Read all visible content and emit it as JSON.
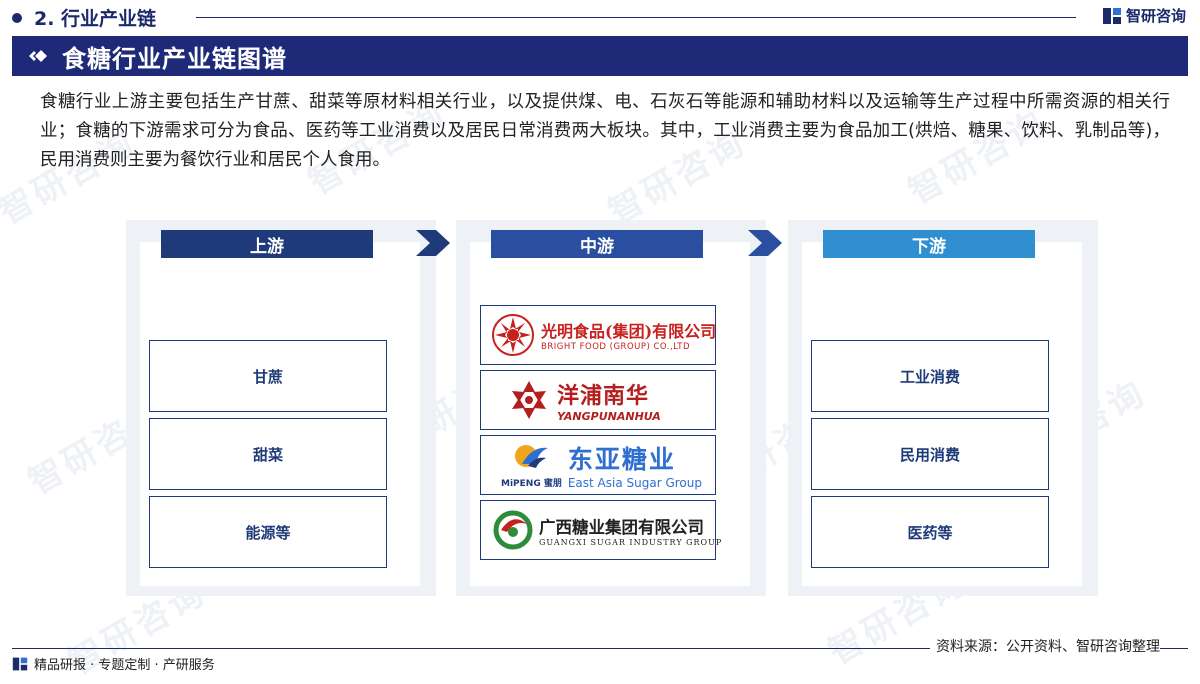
{
  "header": {
    "section_title": "2. 行业产业链",
    "brand": "智研咨询"
  },
  "banner": {
    "title": "食糖行业产业链图谱"
  },
  "intro": "食糖行业上游主要包括生产甘蔗、甜菜等原材料相关行业，以及提供煤、电、石灰石等能源和辅助材料以及运输等生产过程中所需资源的相关行业；食糖的下游需求可分为食品、医药等工业消费以及居民日常消费两大板块。其中，工业消费主要为食品加工(烘焙、糖果、饮料、乳制品等)，民用消费则主要为餐饮行业和居民个人食用。",
  "watermark": "智研咨询",
  "upstream": {
    "label": "上游",
    "items": [
      "甘蔗",
      "甜菜",
      "能源等"
    ]
  },
  "midstream": {
    "label": "中游",
    "companies": [
      {
        "cn": "光明食品(集团)有限公司",
        "en": "BRIGHT FOOD (GROUP) CO.,LTD",
        "icon": "bright-food-logo"
      },
      {
        "cn": "洋浦南华",
        "en": "YANGPUNANHUA",
        "icon": "yangpu-nanhua-logo"
      },
      {
        "cn": "东亚糖业",
        "en": "East Asia Sugar Group",
        "mark": "MiPENG 蜜朋",
        "icon": "east-asia-sugar-logo"
      },
      {
        "cn": "广西糖业集团有限公司",
        "en": "GUANGXI SUGAR INDUSTRY GROUP",
        "icon": "guangxi-sugar-logo"
      }
    ]
  },
  "downstream": {
    "label": "下游",
    "items": [
      "工业消费",
      "民用消费",
      "医药等"
    ]
  },
  "footer": {
    "left": "精品研报 · 专题定制 · 产研服务",
    "source": "资料来源：公开资料、智研咨询整理"
  },
  "colors": {
    "navy": "#1e2a78",
    "upstream_head": "#1e3a78",
    "midstream_head": "#2a4fa0",
    "downstream_head": "#2f8fd0",
    "panel_bg": "#eef1f6"
  }
}
